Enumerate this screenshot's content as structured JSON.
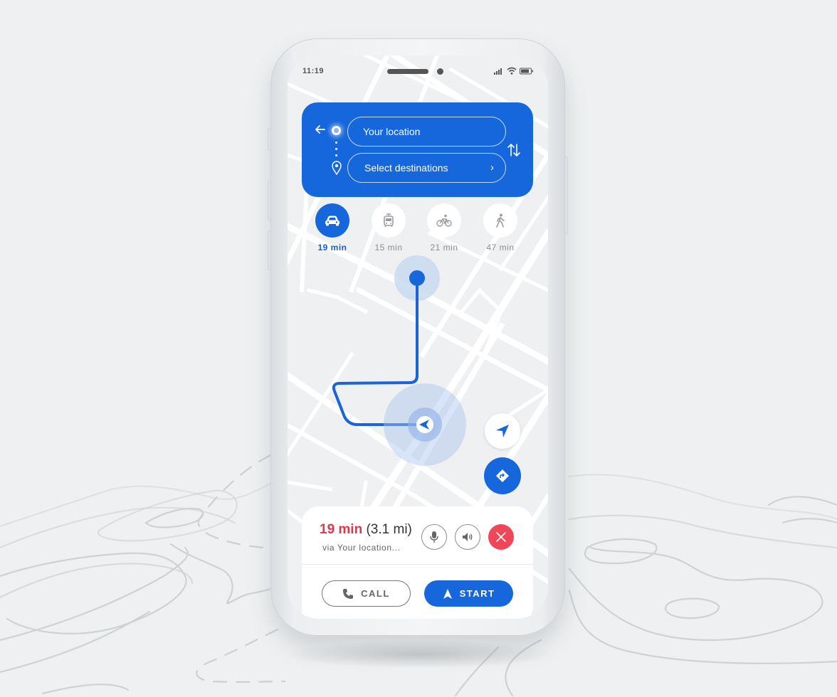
{
  "colors": {
    "accent": "#1767dc",
    "eta_red": "#e2364a",
    "close_red": "#ef4659",
    "map_bg": "#eef0f2",
    "road": "#ffffff",
    "background": "#eef0f1"
  },
  "status_bar": {
    "time": "11:19",
    "icons": [
      "signal-icon",
      "wifi-icon",
      "battery-icon"
    ]
  },
  "route_search": {
    "back_icon": "arrow-left-icon",
    "origin_value": "Your location",
    "destination_placeholder": "Select destinations",
    "destination_chevron": "›",
    "swap_icon": "swap-vertical-icon"
  },
  "transport_modes": [
    {
      "mode": "car",
      "icon": "car-icon",
      "duration": "19 min",
      "selected": true
    },
    {
      "mode": "transit",
      "icon": "tram-icon",
      "duration": "15 min",
      "selected": false
    },
    {
      "mode": "bike",
      "icon": "bicycle-icon",
      "duration": "21 min",
      "selected": false
    },
    {
      "mode": "walk",
      "icon": "walking-icon",
      "duration": "47 min",
      "selected": false
    }
  ],
  "map": {
    "destination_marker": "destination-dot",
    "current_location_marker": "navigation-arrow",
    "locate_button_icon": "location-arrow-icon",
    "directions_button_icon": "directions-turn-icon"
  },
  "trip_sheet": {
    "eta_time": "19 min",
    "eta_distance": "(3.1 mi)",
    "via": "via Your location...",
    "mic_icon": "microphone-icon",
    "sound_icon": "speaker-icon",
    "close_icon": "close-icon",
    "call_label": "CALL",
    "start_label": "START"
  }
}
